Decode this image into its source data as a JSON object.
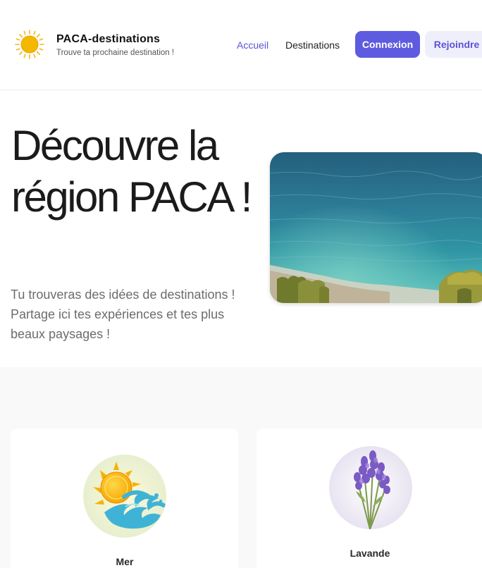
{
  "header": {
    "brand_name": "PACA-destinations",
    "tagline": "Trouve ta prochaine destination !",
    "logo_icon": "sun-icon",
    "nav": [
      {
        "label": "Accueil",
        "active": true
      },
      {
        "label": "Destinations",
        "active": false
      }
    ],
    "login_label": "Connexion",
    "join_label": "Rejoindre"
  },
  "hero": {
    "title": "Découvre la région PACA !",
    "subtitle": "Tu trouveras des idées de destinations ! Partage ici tes expériences et tes plus beaux paysages !",
    "image": "sea-coast-photo"
  },
  "categories": [
    {
      "label": "Mer",
      "icon": "sun-wave-icon"
    },
    {
      "label": "Lavande",
      "icon": "lavender-icon"
    }
  ],
  "colors": {
    "accent": "#5e5be0",
    "accent_light": "#efeffb",
    "section_bg": "#f9f9f9",
    "sun": "#f5b800"
  }
}
